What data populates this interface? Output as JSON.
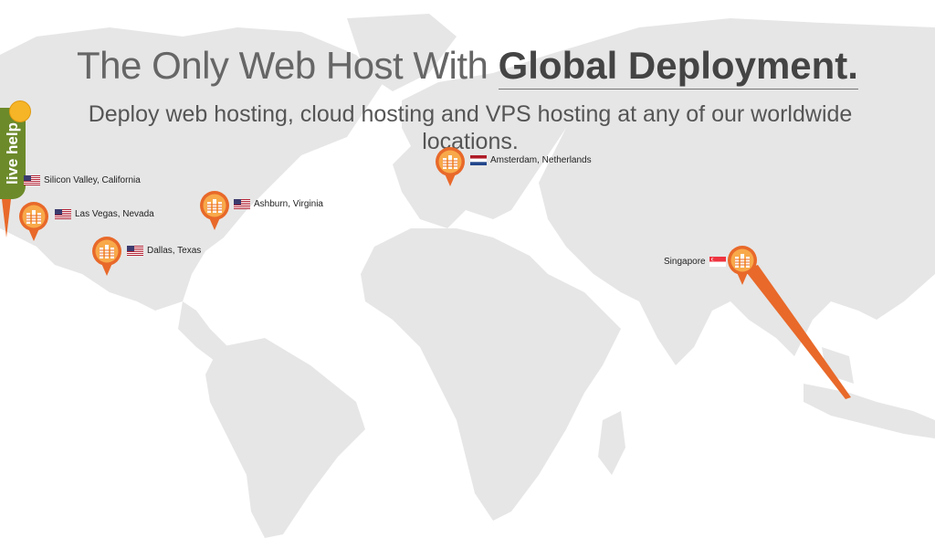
{
  "headline": {
    "light": "The Only Web Host With ",
    "strong": "Global Deployment."
  },
  "subheadline": "Deploy web hosting, cloud hosting and VPS hosting at any of our worldwide locations.",
  "live_help": {
    "label": "live help"
  },
  "locations": [
    {
      "name": "Silicon Valley, California",
      "flag": "us"
    },
    {
      "name": "Las Vegas, Nevada",
      "flag": "us"
    },
    {
      "name": "Dallas, Texas",
      "flag": "us"
    },
    {
      "name": "Ashburn, Virginia",
      "flag": "us"
    },
    {
      "name": "Amsterdam, Netherlands",
      "flag": "nl"
    },
    {
      "name": "Singapore",
      "flag": "sg"
    }
  ],
  "colors": {
    "pin": "#e8692a",
    "pin_light": "#f8a94a",
    "live_help": "#6c8a2a",
    "map": "#e6e6e6"
  }
}
